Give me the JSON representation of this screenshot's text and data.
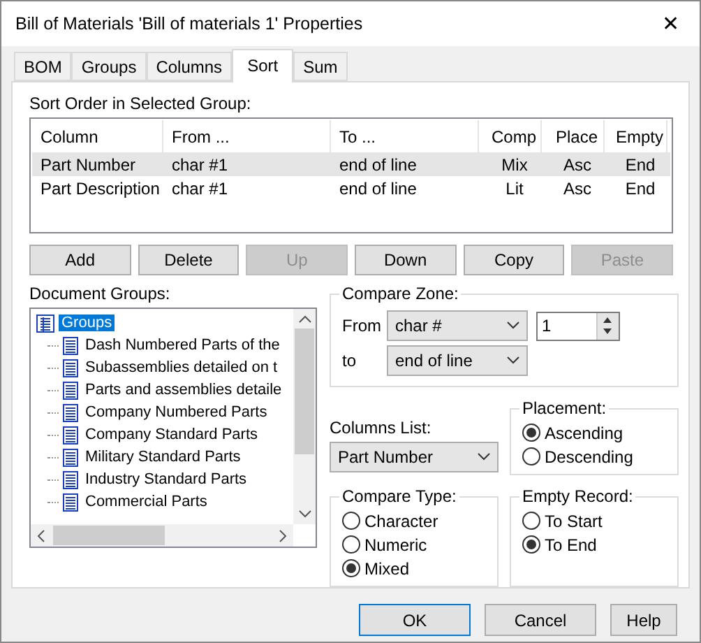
{
  "window": {
    "title": "Bill of Materials 'Bill of materials 1' Properties",
    "close": "✕"
  },
  "tabs": [
    {
      "label": "BOM",
      "selected": false
    },
    {
      "label": "Groups",
      "selected": false
    },
    {
      "label": "Columns",
      "selected": false
    },
    {
      "label": "Sort",
      "selected": true
    },
    {
      "label": "Sum",
      "selected": false
    }
  ],
  "sort_order": {
    "label": "Sort Order in Selected Group:",
    "columns": [
      "Column",
      "From ...",
      "To ...",
      "Comp",
      "Place",
      "Empty"
    ],
    "rows": [
      {
        "cells": [
          "Part Number",
          "char #1",
          "end of line",
          "Mix",
          "Asc",
          "End"
        ],
        "selected": true
      },
      {
        "cells": [
          "Part Description",
          "char #1",
          "end of line",
          "Lit",
          "Asc",
          "End"
        ],
        "selected": false
      }
    ]
  },
  "list_buttons": [
    {
      "label": "Add",
      "disabled": false
    },
    {
      "label": "Delete",
      "disabled": false
    },
    {
      "label": "Up",
      "disabled": true
    },
    {
      "label": "Down",
      "disabled": false
    },
    {
      "label": "Copy",
      "disabled": false
    },
    {
      "label": "Paste",
      "disabled": true
    }
  ],
  "document_groups": {
    "label": "Document Groups:",
    "tree": [
      {
        "label": "Groups",
        "selected": true,
        "children": [
          {
            "label": "Dash Numbered Parts of the",
            "selected": false
          },
          {
            "label": "Subassemblies detailed on t",
            "selected": false
          },
          {
            "label": "Parts and assemblies detaile",
            "selected": false
          },
          {
            "label": "Company Numbered Parts",
            "selected": false
          },
          {
            "label": "Company Standard Parts",
            "selected": false
          },
          {
            "label": "Military Standard Parts",
            "selected": false
          },
          {
            "label": "Industry Standard Parts",
            "selected": false
          },
          {
            "label": "Commercial Parts",
            "selected": false
          }
        ]
      }
    ]
  },
  "compare_zone": {
    "title": "Compare Zone:",
    "from_label": "From",
    "from_value": "char #",
    "from_number": "1",
    "to_label": "to",
    "to_value": "end of line"
  },
  "columns_list": {
    "label": "Columns List:",
    "value": "Part Number"
  },
  "placement": {
    "title": "Placement:",
    "options": [
      {
        "label": "Ascending",
        "selected": true
      },
      {
        "label": "Descending",
        "selected": false
      }
    ]
  },
  "compare_type": {
    "title": "Compare Type:",
    "options": [
      {
        "label": "Character",
        "selected": false
      },
      {
        "label": "Numeric",
        "selected": false
      },
      {
        "label": "Mixed",
        "selected": true
      }
    ]
  },
  "empty_record": {
    "title": "Empty Record:",
    "options": [
      {
        "label": "To Start",
        "selected": false
      },
      {
        "label": "To End",
        "selected": true
      }
    ]
  },
  "dialog_buttons": [
    "OK",
    "Cancel",
    "Help"
  ]
}
